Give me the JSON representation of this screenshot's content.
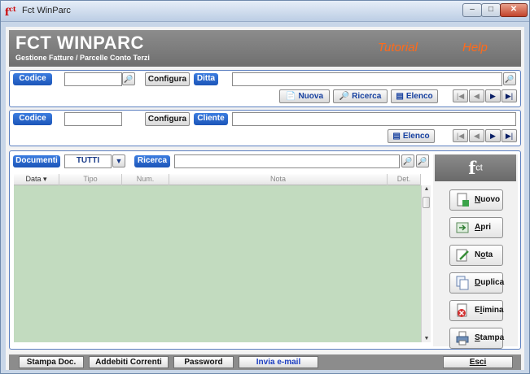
{
  "window": {
    "title": "Fct WinParc",
    "icon_text": "f",
    "icon_sup": "ct",
    "minimize_glyph": "–",
    "maximize_glyph": "□",
    "close_glyph": "✕"
  },
  "banner": {
    "title": "FCT WINPARC",
    "subtitle": "Gestione Fatture / Parcelle Conto Terzi",
    "tutorial_link": "Tutorial",
    "help_link": "Help"
  },
  "ditta_panel": {
    "codice_label": "Codice",
    "codice_value": "",
    "configura_label": "Configura",
    "ditta_label": "Ditta",
    "ditta_value": "",
    "nuova_label": "Nuova",
    "ricerca_label": "Ricerca",
    "elenco_label": "Elenco"
  },
  "cliente_panel": {
    "codice_label": "Codice",
    "codice_value": "",
    "configura_label": "Configura",
    "cliente_label": "Cliente",
    "cliente_value": "",
    "elenco_label": "Elenco"
  },
  "nav": {
    "first": "|◀",
    "prev": "◀",
    "next": "▶",
    "last": "▶|"
  },
  "documents": {
    "label": "Documenti",
    "filter_value": "TUTTI",
    "ricerca_label": "Ricerca",
    "ricerca_value": "",
    "columns": [
      "Data ▾",
      "Tipo",
      "Num.",
      "Nota",
      "Det."
    ],
    "rows": []
  },
  "logo": {
    "text": "f",
    "sup": "ct"
  },
  "actions": {
    "nuovo": {
      "pre": "",
      "u": "N",
      "post": "uovo"
    },
    "apri": {
      "pre": "",
      "u": "A",
      "post": "pri"
    },
    "nota": {
      "pre": "N",
      "u": "o",
      "post": "ta"
    },
    "duplica": {
      "pre": "",
      "u": "D",
      "post": "uplica"
    },
    "elimina": {
      "pre": "E",
      "u": "l",
      "post": "imina"
    },
    "stampa": {
      "pre": "",
      "u": "S",
      "post": "tampa"
    }
  },
  "bottom": {
    "stampa_doc": "Stampa Doc.",
    "addebiti_correnti": "Addebiti Correnti",
    "password": "Password",
    "invia_email": "Invia e-mail",
    "esci": "Esci"
  },
  "colors": {
    "accent_blue": "#1c55b8",
    "banner_gray": "#7a7a7a",
    "link_orange": "#ff6a1a",
    "grid_green": "#c2dbbf"
  }
}
